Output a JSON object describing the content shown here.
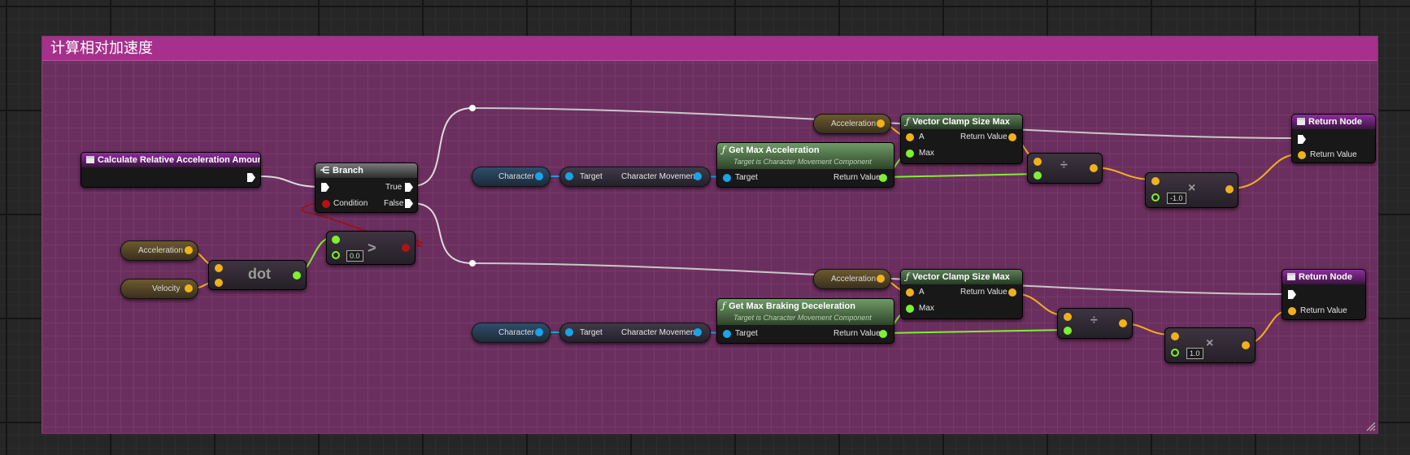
{
  "comment": {
    "title": "计算相对加速度"
  },
  "event": {
    "title": "Calculate Relative Acceleration Amount"
  },
  "branch": {
    "title": "Branch",
    "true_label": "True",
    "false_label": "False",
    "condition_label": "Condition"
  },
  "dot": {
    "label": "dot",
    "in_a": "Acceleration",
    "in_b": "Velocity"
  },
  "compare": {
    "op": ">",
    "default_value": "0.0"
  },
  "top_row": {
    "character": "Character",
    "target": "Target",
    "char_movement": "Character Movement",
    "getter": {
      "title": "Get Max Acceleration",
      "subtitle": "Target is Character Movement Component",
      "target": "Target",
      "return": "Return Value"
    },
    "accel_var": "Acceleration",
    "clamp": {
      "title": "Vector Clamp Size Max",
      "a": "A",
      "max": "Max",
      "return": "Return Value"
    },
    "divide_op": "÷",
    "multiply": {
      "op": "×",
      "value": "-1.0"
    },
    "return_node": {
      "title": "Return Node",
      "return": "Return Value"
    }
  },
  "bottom_row": {
    "character": "Character",
    "target": "Target",
    "char_movement": "Character Movement",
    "getter": {
      "title": "Get Max Braking Deceleration",
      "subtitle": "Target is Character Movement Component",
      "target": "Target",
      "return": "Return Value"
    },
    "accel_var": "Acceleration",
    "clamp": {
      "title": "Vector Clamp Size Max",
      "a": "A",
      "max": "Max",
      "return": "Return Value"
    },
    "divide_op": "÷",
    "multiply": {
      "op": "×",
      "value": "1.0"
    },
    "return_node": {
      "title": "Return Node",
      "return": "Return Value"
    }
  },
  "colors": {
    "comment_header": "#a6308c",
    "comment_body": "#6b2f5f",
    "vector_pin": "#f1b11c",
    "object_pin": "#1aa3e8",
    "float_pin": "#7ff032",
    "bool_pin": "#b31212"
  }
}
